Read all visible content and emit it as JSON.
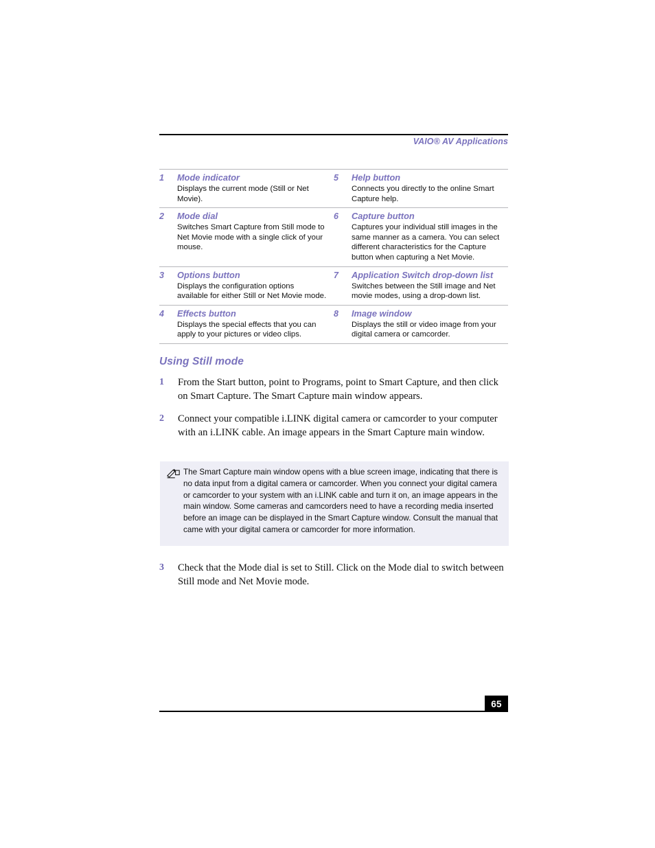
{
  "header": {
    "title": "VAIO® AV Applications"
  },
  "reference_table": {
    "rows": [
      {
        "left": {
          "number": "1",
          "label": "Mode indicator",
          "description": "Displays the current mode (Still or Net Movie)."
        },
        "right": {
          "number": "5",
          "label": "Help button",
          "description": "Connects you directly to the online Smart Capture help."
        }
      },
      {
        "left": {
          "number": "2",
          "label": "Mode dial",
          "description": "Switches Smart Capture from Still mode to Net Movie mode with a single click of your mouse."
        },
        "right": {
          "number": "6",
          "label": "Capture button",
          "description": "Captures your individual still images in the same manner as a camera. You can select different characteristics for the Capture button when capturing a Net Movie."
        }
      },
      {
        "left": {
          "number": "3",
          "label": "Options button",
          "description": "Displays the configuration options available for either Still or Net Movie mode."
        },
        "right": {
          "number": "7",
          "label": "Application Switch drop-down list",
          "description": "Switches between the Still image and Net movie modes, using a drop-down list."
        }
      },
      {
        "left": {
          "number": "4",
          "label": "Effects button",
          "description": "Displays the special effects that you can apply to your pictures or video clips."
        },
        "right": {
          "number": "8",
          "label": "Image window",
          "description": "Displays the still or video image from your digital camera or camcorder."
        }
      }
    ]
  },
  "section": {
    "heading": "Using Still mode",
    "steps": [
      {
        "number": "1",
        "text": "From the Start button, point to Programs, point to Smart Capture, and then click on Smart Capture. The Smart Capture main window appears."
      },
      {
        "number": "2",
        "text": "Connect your compatible i.LINK digital camera or camcorder to your computer with an i.LINK cable. An image appears in the Smart Capture main window."
      },
      {
        "number": "3",
        "text": "Check that the Mode dial is set to Still. Click on the Mode dial to switch between Still mode and Net Movie mode."
      }
    ]
  },
  "note": {
    "icon": "pencil-note-icon",
    "text": "The Smart Capture main window opens with a blue screen image, indicating that there is no data input from a digital camera or camcorder. When you connect your digital camera or camcorder to your system with an i.LINK cable and turn it on, an image appears in the main window. Some cameras and camcorders need to have a recording media inserted before an image can be displayed in the Smart Capture window. Consult the manual that came with your digital camera or camcorder for more information.",
    "background_color": "#eeeef6"
  },
  "footer": {
    "page_number": "65"
  },
  "colors": {
    "accent_purple": "#7a72bd",
    "rule_black": "#000000",
    "table_rule_gray": "#b7b7bb"
  }
}
